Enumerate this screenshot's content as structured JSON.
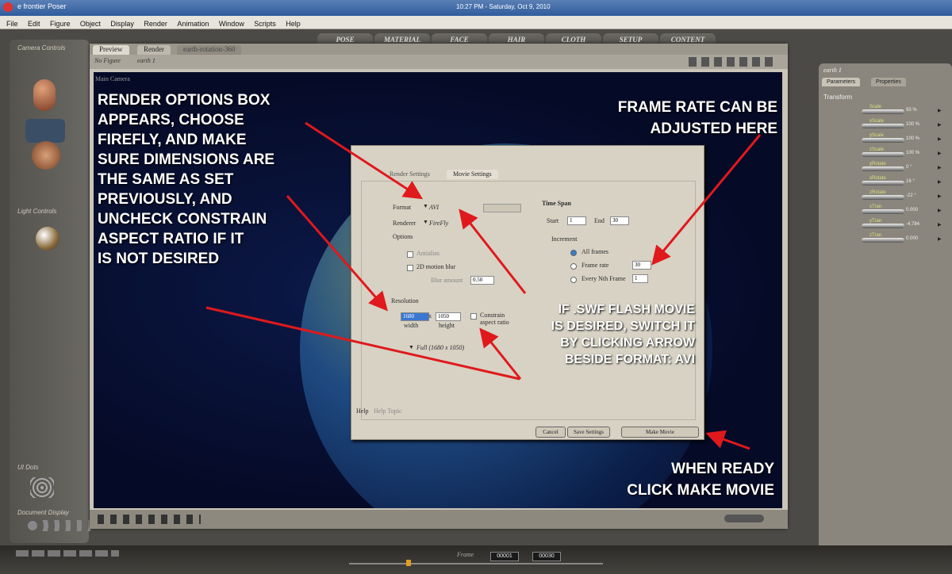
{
  "taskbar": {
    "app_title": "e frontier Poser",
    "clock": "10:27 PM - Saturday, Oct 9, 2010"
  },
  "menu": [
    "File",
    "Edit",
    "Figure",
    "Object",
    "Display",
    "Render",
    "Animation",
    "Window",
    "Scripts",
    "Help"
  ],
  "room_tabs": [
    "POSE",
    "MATERIAL",
    "FACE",
    "HAIR",
    "CLOTH",
    "SETUP",
    "CONTENT"
  ],
  "left_panel": {
    "camera_controls": "Camera Controls",
    "light_controls": "Light Controls",
    "ui_dots": "UI Dots",
    "document_display": "Document Display"
  },
  "window": {
    "tabs": [
      "Preview",
      "Render",
      "earth-rotation-360"
    ],
    "no_figure": "No Figure",
    "object": "earth 1",
    "camera": "Main Camera"
  },
  "right_panel": {
    "object": "earth 1",
    "tabs": [
      "Parameters",
      "Properties"
    ],
    "group": "Transform",
    "params": [
      {
        "name": "Scale",
        "value": "93 %"
      },
      {
        "name": "xScale",
        "value": "100 %"
      },
      {
        "name": "yScale",
        "value": "100 %"
      },
      {
        "name": "zScale",
        "value": "100 %"
      },
      {
        "name": "yRotate",
        "value": "0 °"
      },
      {
        "name": "xRotate",
        "value": "16 °"
      },
      {
        "name": "zRotate",
        "value": "-22 °"
      },
      {
        "name": "xTran",
        "value": "0.000"
      },
      {
        "name": "yTran",
        "value": "-4.784"
      },
      {
        "name": "zTran",
        "value": "0.000"
      }
    ]
  },
  "dialog": {
    "tabs": [
      "Render Settings",
      "Movie Settings"
    ],
    "format_label": "Format",
    "format_value": "AVI",
    "renderer_label": "Renderer",
    "renderer_value": "FireFly",
    "options_label": "Options",
    "antialias": "Antialias",
    "motion_blur": "2D motion blur",
    "blur_amount_label": "Blur amount",
    "blur_amount": "0.50",
    "time_span": "Time Span",
    "start_label": "Start",
    "start": "1",
    "end_label": "End",
    "end": "30",
    "increment": "Increment",
    "all_frames": "All frames",
    "frame_rate_label": "Frame rate",
    "frame_rate": "30",
    "every_nth_label": "Every Nth Frame",
    "every_nth": "1",
    "resolution": "Resolution",
    "width": "1680",
    "height": "1050",
    "x_sep": "x",
    "width_label": "width",
    "height_label": "height",
    "constrain": "Constrain aspect ratio",
    "preset": "Full (1680 x 1050)",
    "help": "Help",
    "help_topic": "Help Topic",
    "cancel": "Cancel",
    "save": "Save Settings",
    "make": "Make Movie"
  },
  "timeline": {
    "frame_label": "Frame",
    "frame": "00001",
    "total": "00030"
  },
  "annotations": {
    "render_options": [
      "RENDER OPTIONS BOX",
      "APPEARS, CHOOSE",
      "FIREFLY, AND MAKE",
      "SURE DIMENSIONS ARE",
      "THE SAME AS SET",
      "PREVIOUSLY, AND",
      "UNCHECK CONSTRAIN",
      "ASPECT RATIO IF IT",
      "IS NOT DESIRED"
    ],
    "frame_rate": [
      "FRAME RATE CAN BE",
      "ADJUSTED HERE"
    ],
    "swf": [
      "IF .SWF FLASH MOVIE",
      "IS DESIRED, SWITCH IT",
      "BY CLICKING ARROW",
      "BESIDE FORMAT: AVI"
    ],
    "make_movie": [
      "WHEN READY",
      "CLICK MAKE MOVIE"
    ]
  },
  "colors": {
    "annotation_arrow": "#e0191c",
    "annotation_text": "#ffffff",
    "viewport_bg": "#050a26"
  }
}
